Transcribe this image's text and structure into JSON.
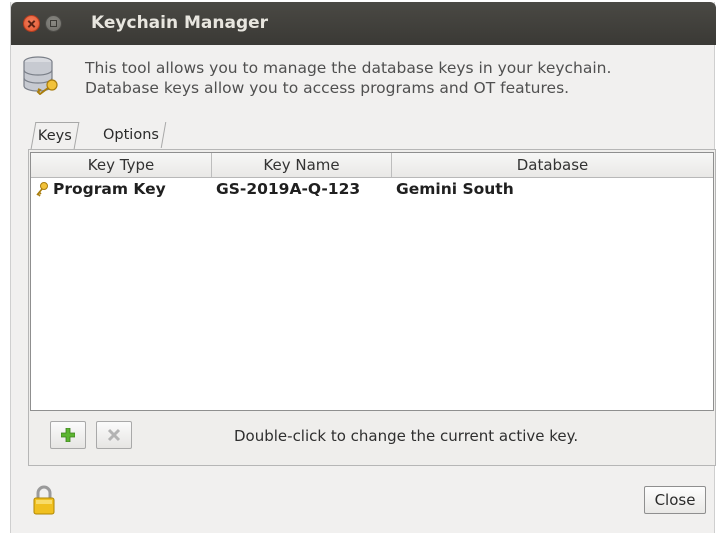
{
  "window": {
    "title": "Keychain Manager"
  },
  "intro": {
    "line1": "This tool allows you to manage the database keys in your keychain.",
    "line2": "Database keys allow you to access programs and OT features."
  },
  "tabs": [
    {
      "label": "Keys",
      "active": true
    },
    {
      "label": "Options",
      "active": false
    }
  ],
  "table": {
    "columns": [
      "Key Type",
      "Key Name",
      "Database"
    ],
    "rows": [
      {
        "type": "Program Key",
        "name": "GS-2019A-Q-123",
        "database": "Gemini South",
        "icon": "key-icon"
      }
    ]
  },
  "footer": {
    "hint": "Double-click to change the current active key.",
    "close_label": "Close"
  },
  "icons": {
    "header": "database-key-icon",
    "add": "add-icon",
    "delete": "delete-icon",
    "lock": "lock-icon"
  },
  "colors": {
    "titlebar": "#3c3b37",
    "close_button": "#e95420",
    "add_icon": "#4caf2c",
    "key_icon": "#d4a017"
  }
}
